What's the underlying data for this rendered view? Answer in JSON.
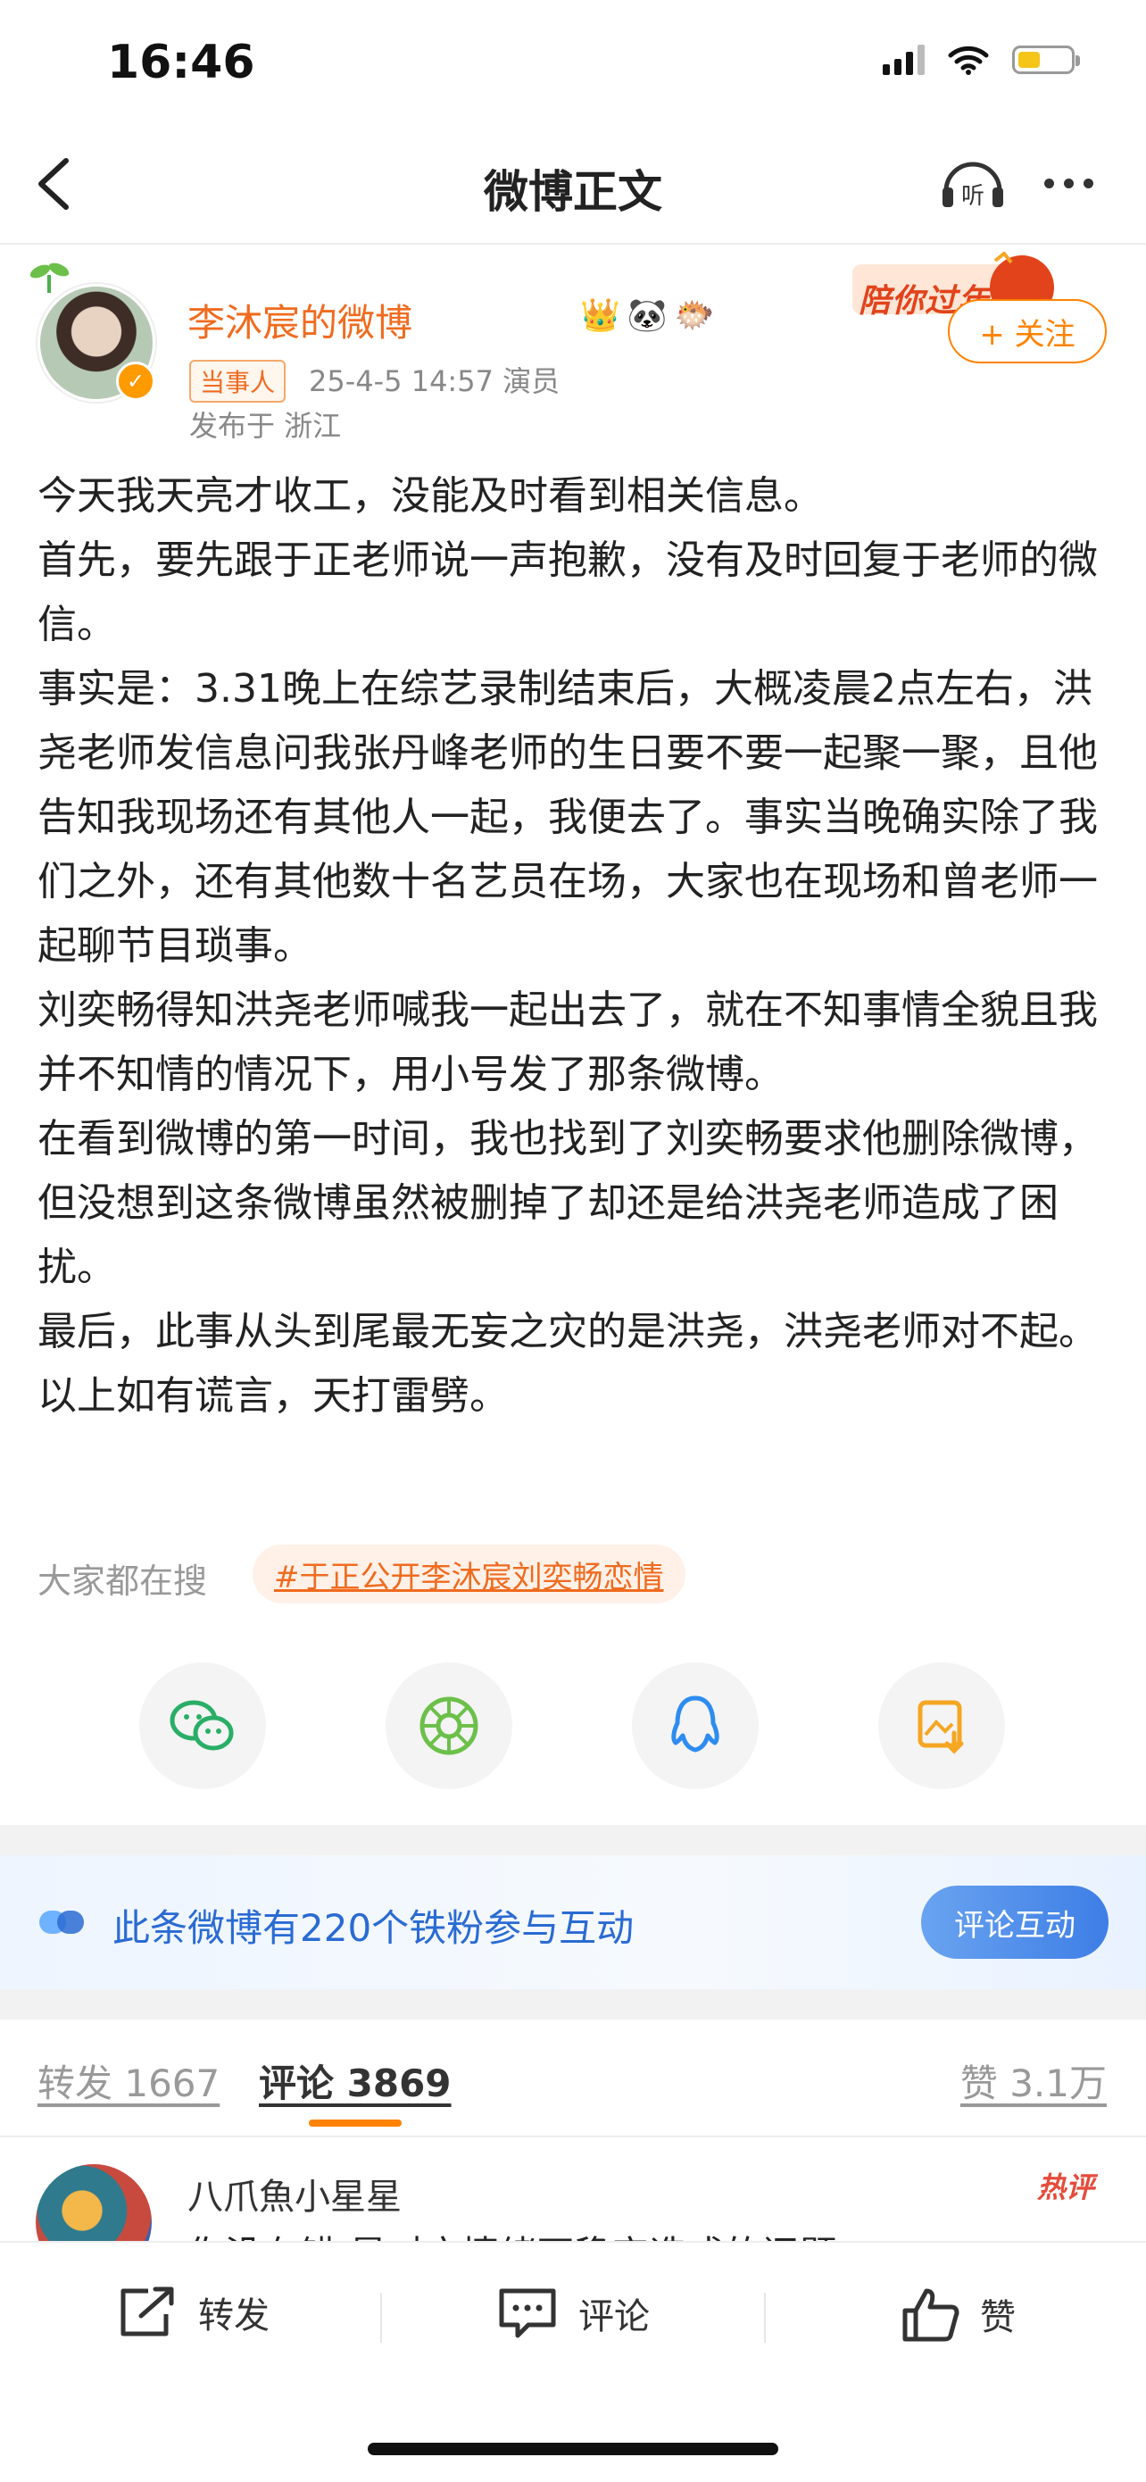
{
  "status_bar": {
    "time": "16:46"
  },
  "nav": {
    "title": "微博正文",
    "listen_label": "听"
  },
  "author": {
    "name": "李沐宸的微博",
    "tag": "当事人",
    "meta": "25-4-5 14:57  演员",
    "location": "发布于 浙江",
    "follow_label": "+ 关注",
    "banner_text": "陪你过年"
  },
  "post": {
    "lines": [
      "今天我天亮才收工，没能及时看到相关信息。",
      "首先，要先跟于正老师说一声抱歉，没有及时回复于老师的微信。",
      "事实是：3.31晚上在综艺录制结束后，大概凌晨2点左右，洪尧老师发信息问我张丹峰老师的生日要不要一起聚一聚，且他告知我现场还有其他人一起，我便去了。事实当晚确实除了我们之外，还有其他数十名艺员在场，大家也在现场和曾老师一起聊节目琐事。",
      "刘奕畅得知洪尧老师喊我一起出去了，就在不知事情全貌且我并不知情的情况下，用小号发了那条微博。",
      "在看到微博的第一时间，我也找到了刘奕畅要求他删除微博，但没想到这条微博虽然被删掉了却还是给洪尧老师造成了困扰。",
      "最后，此事从头到尾最无妄之灾的是洪尧，洪尧老师对不起。",
      "以上如有谎言，天打雷劈。"
    ]
  },
  "search": {
    "label": "大家都在搜",
    "tag": "#于正公开李沐宸刘奕畅恋情"
  },
  "share": {
    "items": [
      "wechat-icon",
      "moments-icon",
      "qq-icon",
      "save-image-icon"
    ]
  },
  "fans": {
    "text": "此条微博有220个铁粉参与互动",
    "button": "评论互动"
  },
  "tabs": {
    "repost": "转发 1667",
    "comment": "评论 3869",
    "like": "赞 3.1万"
  },
  "comment": {
    "name": "八爪魚小星星",
    "text": "你没有错 是对方情绪不稳定造成的问题",
    "badge": "热评"
  },
  "bottom_bar": {
    "repost": "转发",
    "comment": "评论",
    "like": "赞"
  },
  "colors": {
    "accent": "#ff8200",
    "link": "#f06b1f",
    "blue": "#2a6bd3"
  }
}
